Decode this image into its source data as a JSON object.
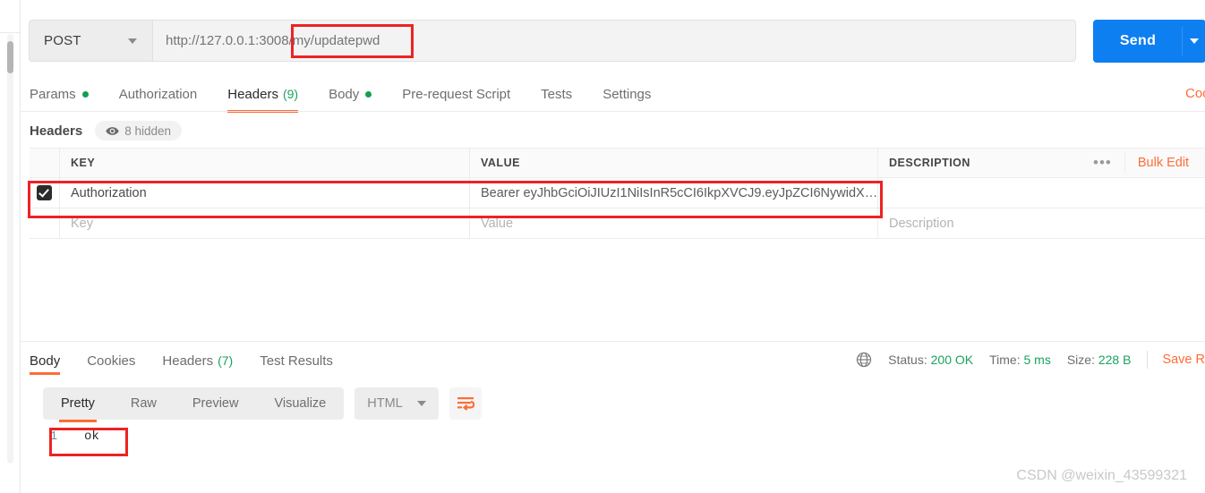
{
  "request": {
    "method": "POST",
    "url": "http://127.0.0.1:3008/my/updatepwd",
    "send_label": "Send",
    "tabs": [
      {
        "label": "Params",
        "dot": true,
        "count": "",
        "active": false
      },
      {
        "label": "Authorization",
        "dot": false,
        "count": "",
        "active": false
      },
      {
        "label": "Headers",
        "dot": false,
        "count": "(9)",
        "active": true
      },
      {
        "label": "Body",
        "dot": true,
        "count": "",
        "active": false
      },
      {
        "label": "Pre-request Script",
        "dot": false,
        "count": "",
        "active": false
      },
      {
        "label": "Tests",
        "dot": false,
        "count": "",
        "active": false
      },
      {
        "label": "Settings",
        "dot": false,
        "count": "",
        "active": false
      }
    ],
    "tabs_right_label": "Cookies"
  },
  "headers_panel": {
    "title": "Headers",
    "hidden_badge": "8 hidden",
    "columns": [
      "KEY",
      "VALUE",
      "DESCRIPTION"
    ],
    "bulk_edit_label": "Bulk Edit",
    "dots_label": "•••",
    "rows": [
      {
        "checked": true,
        "key": "Authorization",
        "value": "Bearer eyJhbGciOiJIUzI1NiIsInR5cCI6IkpXVCJ9.eyJpZCI6NywidX…",
        "description": ""
      }
    ],
    "placeholder_row": {
      "key": "Key",
      "value": "Value",
      "description": "Description"
    }
  },
  "response": {
    "tabs": [
      {
        "label": "Body",
        "count": "",
        "active": true
      },
      {
        "label": "Cookies",
        "count": "",
        "active": false
      },
      {
        "label": "Headers",
        "count": "(7)",
        "active": false
      },
      {
        "label": "Test Results",
        "count": "",
        "active": false
      }
    ],
    "meta": {
      "status_label": "Status:",
      "status_value": "200 OK",
      "time_label": "Time:",
      "time_value": "5 ms",
      "size_label": "Size:",
      "size_value": "228 B",
      "save_label": "Save R"
    },
    "view_modes": [
      {
        "label": "Pretty",
        "active": true
      },
      {
        "label": "Raw",
        "active": false
      },
      {
        "label": "Preview",
        "active": false
      },
      {
        "label": "Visualize",
        "active": false
      }
    ],
    "format": "HTML",
    "body": {
      "line_number": "1",
      "text": "ok"
    }
  },
  "watermark": "CSDN @weixin_43599321",
  "colors": {
    "accent_orange": "#ff6c37",
    "send_blue": "#0d7ff1",
    "status_green": "#1aa260",
    "annotation_red": "#ed2224"
  }
}
